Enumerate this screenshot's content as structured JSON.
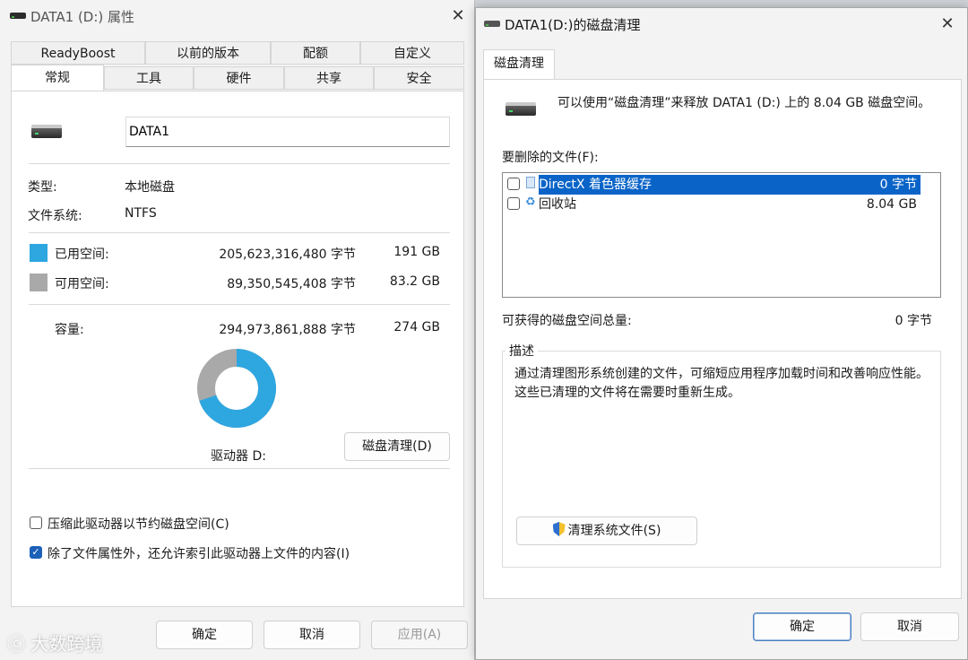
{
  "left_window": {
    "title": "DATA1 (D:) 属性",
    "tabs_row1": [
      "ReadyBoost",
      "以前的版本",
      "配额",
      "自定义"
    ],
    "tabs_row2": [
      "常规",
      "工具",
      "硬件",
      "共享",
      "安全"
    ],
    "drive_name_value": "DATA1",
    "type_label": "类型:",
    "type_value": "本地磁盘",
    "fs_label": "文件系统:",
    "fs_value": "NTFS",
    "used": {
      "label": "已用空间:",
      "bytes": "205,623,316,480 字节",
      "size": "191 GB",
      "color": "#2ea6e0"
    },
    "free": {
      "label": "可用空间:",
      "bytes": "89,350,545,408 字节",
      "size": "83.2 GB",
      "color": "#a9a9a9"
    },
    "capacity": {
      "label": "容量:",
      "bytes": "294,973,861,888 字节",
      "size": "274 GB"
    },
    "used_fraction": 0.697,
    "drive_label": "驱动器 D:",
    "cleanup_button": "磁盘清理(D)",
    "compress_label": "压缩此驱动器以节约磁盘空间(C)",
    "compress_checked": false,
    "index_label": "除了文件属性外，还允许索引此驱动器上文件的内容(I)",
    "index_checked": true,
    "ok_button": "确定",
    "cancel_button": "取消",
    "apply_button": "应用(A)"
  },
  "right_window": {
    "title": "DATA1(D:)的磁盘清理",
    "tab": "磁盘清理",
    "intro_text": "可以使用“磁盘清理”来释放 DATA1 (D:) 上的 8.04 GB 磁盘空间。",
    "files_label": "要删除的文件(F):",
    "files": [
      {
        "name": "DirectX 着色器缓存",
        "size": "0 字节",
        "checked": false,
        "selected": true
      },
      {
        "name": "回收站",
        "size": "8.04 GB",
        "checked": false,
        "selected": false
      }
    ],
    "total_label": "可获得的磁盘空间总量:",
    "total_value": "0 字节",
    "description_label": "描述",
    "description_text": "通过清理图形系统创建的文件，可缩短应用程序加载时间和改善响应性能。这些已清理的文件将在需要时重新生成。",
    "clean_system_button": "清理系统文件(S)",
    "ok_button": "确定",
    "cancel_button": "取消"
  },
  "watermark": "大数跨境"
}
